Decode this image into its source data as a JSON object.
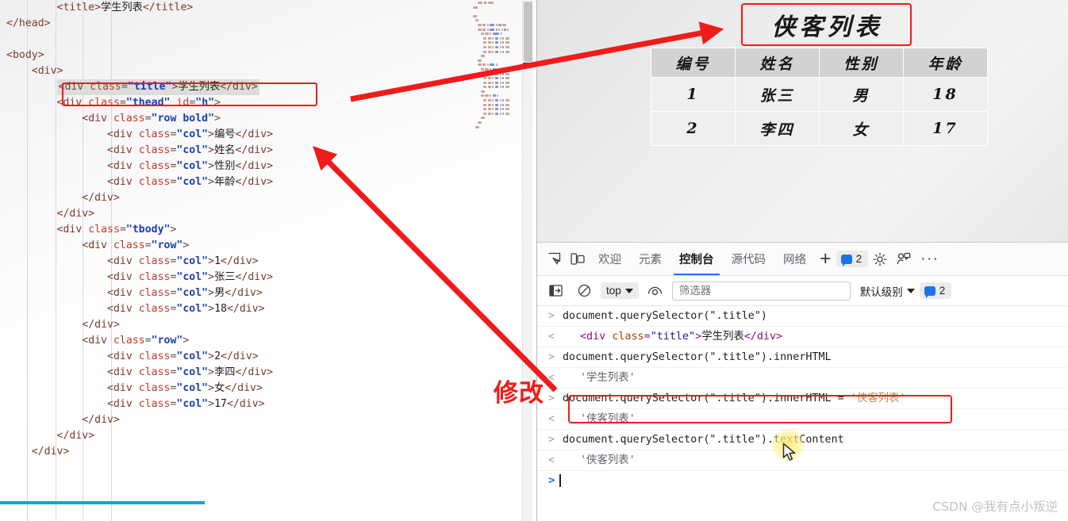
{
  "editor": {
    "code_lines": [
      {
        "indent": 2,
        "parts": [
          {
            "t": "tag",
            "v": "<title>"
          },
          {
            "t": "txt",
            "v": "学生列表"
          },
          {
            "t": "tag",
            "v": "</title>"
          }
        ]
      },
      {
        "indent": 0,
        "parts": [
          {
            "t": "tag",
            "v": "</head>"
          }
        ]
      },
      {
        "indent": 0,
        "parts": []
      },
      {
        "indent": 0,
        "parts": [
          {
            "t": "tag",
            "v": "<body>"
          }
        ]
      },
      {
        "indent": 1,
        "parts": [
          {
            "t": "tag",
            "v": "<div>"
          }
        ]
      },
      {
        "indent": 2,
        "highlight": true,
        "parts": [
          {
            "t": "tag",
            "v": "<div "
          },
          {
            "t": "attr",
            "v": "class"
          },
          {
            "t": "eq",
            "v": "="
          },
          {
            "t": "val",
            "v": "\"title\""
          },
          {
            "t": "tag",
            "v": ">"
          },
          {
            "t": "txt",
            "v": "学生列表"
          },
          {
            "t": "tag",
            "v": "</div>"
          }
        ]
      },
      {
        "indent": 2,
        "parts": [
          {
            "t": "tag",
            "v": "<div "
          },
          {
            "t": "attr",
            "v": "class"
          },
          {
            "t": "eq",
            "v": "="
          },
          {
            "t": "val",
            "v": "\"thead\""
          },
          {
            "t": "txt",
            "v": " "
          },
          {
            "t": "attr",
            "v": "id"
          },
          {
            "t": "eq",
            "v": "="
          },
          {
            "t": "val",
            "v": "\"h\""
          },
          {
            "t": "tag",
            "v": ">"
          }
        ]
      },
      {
        "indent": 3,
        "parts": [
          {
            "t": "tag",
            "v": "<div "
          },
          {
            "t": "attr",
            "v": "class"
          },
          {
            "t": "eq",
            "v": "="
          },
          {
            "t": "val",
            "v": "\"row bold\""
          },
          {
            "t": "tag",
            "v": ">"
          }
        ]
      },
      {
        "indent": 4,
        "parts": [
          {
            "t": "tag",
            "v": "<div "
          },
          {
            "t": "attr",
            "v": "class"
          },
          {
            "t": "eq",
            "v": "="
          },
          {
            "t": "val",
            "v": "\"col\""
          },
          {
            "t": "tag",
            "v": ">"
          },
          {
            "t": "txt",
            "v": "编号"
          },
          {
            "t": "tag",
            "v": "</div>"
          }
        ]
      },
      {
        "indent": 4,
        "parts": [
          {
            "t": "tag",
            "v": "<div "
          },
          {
            "t": "attr",
            "v": "class"
          },
          {
            "t": "eq",
            "v": "="
          },
          {
            "t": "val",
            "v": "\"col\""
          },
          {
            "t": "tag",
            "v": ">"
          },
          {
            "t": "txt",
            "v": "姓名"
          },
          {
            "t": "tag",
            "v": "</div>"
          }
        ]
      },
      {
        "indent": 4,
        "parts": [
          {
            "t": "tag",
            "v": "<div "
          },
          {
            "t": "attr",
            "v": "class"
          },
          {
            "t": "eq",
            "v": "="
          },
          {
            "t": "val",
            "v": "\"col\""
          },
          {
            "t": "tag",
            "v": ">"
          },
          {
            "t": "txt",
            "v": "性别"
          },
          {
            "t": "tag",
            "v": "</div>"
          }
        ]
      },
      {
        "indent": 4,
        "parts": [
          {
            "t": "tag",
            "v": "<div "
          },
          {
            "t": "attr",
            "v": "class"
          },
          {
            "t": "eq",
            "v": "="
          },
          {
            "t": "val",
            "v": "\"col\""
          },
          {
            "t": "tag",
            "v": ">"
          },
          {
            "t": "txt",
            "v": "年龄"
          },
          {
            "t": "tag",
            "v": "</div>"
          }
        ]
      },
      {
        "indent": 3,
        "parts": [
          {
            "t": "tag",
            "v": "</div>"
          }
        ]
      },
      {
        "indent": 2,
        "parts": [
          {
            "t": "tag",
            "v": "</div>"
          }
        ]
      },
      {
        "indent": 2,
        "parts": [
          {
            "t": "tag",
            "v": "<div "
          },
          {
            "t": "attr",
            "v": "class"
          },
          {
            "t": "eq",
            "v": "="
          },
          {
            "t": "val",
            "v": "\"tbody\""
          },
          {
            "t": "tag",
            "v": ">"
          }
        ]
      },
      {
        "indent": 3,
        "parts": [
          {
            "t": "tag",
            "v": "<div "
          },
          {
            "t": "attr",
            "v": "class"
          },
          {
            "t": "eq",
            "v": "="
          },
          {
            "t": "val",
            "v": "\"row\""
          },
          {
            "t": "tag",
            "v": ">"
          }
        ]
      },
      {
        "indent": 4,
        "parts": [
          {
            "t": "tag",
            "v": "<div "
          },
          {
            "t": "attr",
            "v": "class"
          },
          {
            "t": "eq",
            "v": "="
          },
          {
            "t": "val",
            "v": "\"col\""
          },
          {
            "t": "tag",
            "v": ">"
          },
          {
            "t": "txt",
            "v": "1"
          },
          {
            "t": "tag",
            "v": "</div>"
          }
        ]
      },
      {
        "indent": 4,
        "parts": [
          {
            "t": "tag",
            "v": "<div "
          },
          {
            "t": "attr",
            "v": "class"
          },
          {
            "t": "eq",
            "v": "="
          },
          {
            "t": "val",
            "v": "\"col\""
          },
          {
            "t": "tag",
            "v": ">"
          },
          {
            "t": "txt",
            "v": "张三"
          },
          {
            "t": "tag",
            "v": "</div>"
          }
        ]
      },
      {
        "indent": 4,
        "parts": [
          {
            "t": "tag",
            "v": "<div "
          },
          {
            "t": "attr",
            "v": "class"
          },
          {
            "t": "eq",
            "v": "="
          },
          {
            "t": "val",
            "v": "\"col\""
          },
          {
            "t": "tag",
            "v": ">"
          },
          {
            "t": "txt",
            "v": "男"
          },
          {
            "t": "tag",
            "v": "</div>"
          }
        ]
      },
      {
        "indent": 4,
        "parts": [
          {
            "t": "tag",
            "v": "<div "
          },
          {
            "t": "attr",
            "v": "class"
          },
          {
            "t": "eq",
            "v": "="
          },
          {
            "t": "val",
            "v": "\"col\""
          },
          {
            "t": "tag",
            "v": ">"
          },
          {
            "t": "txt",
            "v": "18"
          },
          {
            "t": "tag",
            "v": "</div>"
          }
        ]
      },
      {
        "indent": 3,
        "parts": [
          {
            "t": "tag",
            "v": "</div>"
          }
        ]
      },
      {
        "indent": 3,
        "parts": [
          {
            "t": "tag",
            "v": "<div "
          },
          {
            "t": "attr",
            "v": "class"
          },
          {
            "t": "eq",
            "v": "="
          },
          {
            "t": "val",
            "v": "\"row\""
          },
          {
            "t": "tag",
            "v": ">"
          }
        ]
      },
      {
        "indent": 4,
        "parts": [
          {
            "t": "tag",
            "v": "<div "
          },
          {
            "t": "attr",
            "v": "class"
          },
          {
            "t": "eq",
            "v": "="
          },
          {
            "t": "val",
            "v": "\"col\""
          },
          {
            "t": "tag",
            "v": ">"
          },
          {
            "t": "txt",
            "v": "2"
          },
          {
            "t": "tag",
            "v": "</div>"
          }
        ]
      },
      {
        "indent": 4,
        "parts": [
          {
            "t": "tag",
            "v": "<div "
          },
          {
            "t": "attr",
            "v": "class"
          },
          {
            "t": "eq",
            "v": "="
          },
          {
            "t": "val",
            "v": "\"col\""
          },
          {
            "t": "tag",
            "v": ">"
          },
          {
            "t": "txt",
            "v": "李四"
          },
          {
            "t": "tag",
            "v": "</div>"
          }
        ]
      },
      {
        "indent": 4,
        "parts": [
          {
            "t": "tag",
            "v": "<div "
          },
          {
            "t": "attr",
            "v": "class"
          },
          {
            "t": "eq",
            "v": "="
          },
          {
            "t": "val",
            "v": "\"col\""
          },
          {
            "t": "tag",
            "v": ">"
          },
          {
            "t": "txt",
            "v": "女"
          },
          {
            "t": "tag",
            "v": "</div>"
          }
        ]
      },
      {
        "indent": 4,
        "parts": [
          {
            "t": "tag",
            "v": "<div "
          },
          {
            "t": "attr",
            "v": "class"
          },
          {
            "t": "eq",
            "v": "="
          },
          {
            "t": "val",
            "v": "\"col\""
          },
          {
            "t": "tag",
            "v": ">"
          },
          {
            "t": "txt",
            "v": "17"
          },
          {
            "t": "tag",
            "v": "</div>"
          }
        ]
      },
      {
        "indent": 3,
        "parts": [
          {
            "t": "tag",
            "v": "</div>"
          }
        ]
      },
      {
        "indent": 2,
        "parts": [
          {
            "t": "tag",
            "v": "</div>"
          }
        ]
      },
      {
        "indent": 1,
        "parts": [
          {
            "t": "tag",
            "v": "</div>"
          }
        ]
      }
    ]
  },
  "page": {
    "title": "侠客列表",
    "table": {
      "headers": [
        "编号",
        "姓名",
        "性别",
        "年龄"
      ],
      "rows": [
        [
          "1",
          "张三",
          "男",
          "18"
        ],
        [
          "2",
          "李四",
          "女",
          "17"
        ]
      ]
    }
  },
  "devtools": {
    "tabs": [
      {
        "label": "欢迎",
        "active": false
      },
      {
        "label": "元素",
        "active": false
      },
      {
        "label": "控制台",
        "active": true
      },
      {
        "label": "源代码",
        "active": false
      },
      {
        "label": "网络",
        "active": false
      }
    ],
    "plus_label": "+",
    "message_count": "2",
    "more_label": "···",
    "filter": {
      "context": "top",
      "placeholder": "筛选器",
      "level": "默认级别",
      "level_count": "2"
    },
    "console": [
      {
        "kind": "input",
        "marker": ">",
        "text": "document.querySelector(\".title\")"
      },
      {
        "kind": "output-html",
        "marker": "<",
        "html": {
          "open": "<div ",
          "attr": "class",
          "eq": "=",
          "val": "\"title\"",
          "gt": ">",
          "text": "学生列表",
          "close": "</div>"
        }
      },
      {
        "kind": "input",
        "marker": ">",
        "text": "document.querySelector(\".title\").innerHTML"
      },
      {
        "kind": "output",
        "marker": "<",
        "text": "'学生列表'"
      },
      {
        "kind": "input-boxed",
        "marker": ">",
        "prefix": "document.querySelector(\".title\").innerHTML = ",
        "value": "'侠客列表'"
      },
      {
        "kind": "output",
        "marker": "<",
        "text": "'侠客列表'"
      },
      {
        "kind": "input",
        "marker": ">",
        "text": "document.querySelector(\".title\").textContent"
      },
      {
        "kind": "output",
        "marker": "<",
        "text": "'侠客列表'"
      }
    ],
    "prompt_marker": ">"
  },
  "annotations": {
    "modify_label": "修改",
    "accent_red": "#f01b1b",
    "accent_blue": "#18a0e0"
  },
  "watermark": "CSDN @我有点小叛逆"
}
